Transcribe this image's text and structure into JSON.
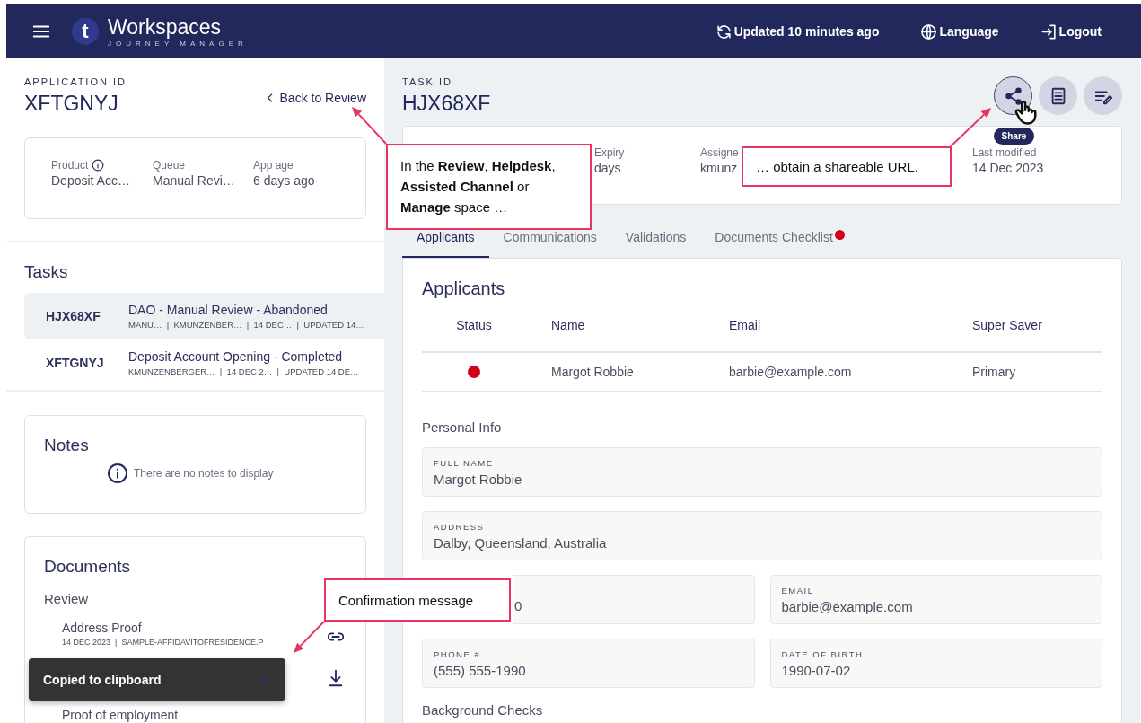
{
  "header": {
    "brand_initial": "t",
    "brand_name": "Workspaces",
    "brand_subtitle": "JOURNEY MANAGER",
    "actions": [
      {
        "label": "Updated 10 minutes ago"
      },
      {
        "label": "Language"
      },
      {
        "label": "Logout"
      }
    ]
  },
  "application": {
    "label": "APPLICATION ID",
    "id": "XFTGNYJ",
    "back_link": "Back to Review",
    "fields": [
      {
        "label": "Product",
        "value": "Deposit Acc…",
        "info": true
      },
      {
        "label": "Queue",
        "value": "Manual Revi…",
        "info": false
      },
      {
        "label": "App age",
        "value": "6 days ago",
        "info": false
      }
    ]
  },
  "tasks": {
    "title": "Tasks",
    "items": [
      {
        "id": "HJX68XF",
        "title": "DAO - Manual Review - Abandoned",
        "meta": "MANU…  |  KMUNZENBER…  |  14 DEC…  |  UPDATED 14…",
        "selected": true
      },
      {
        "id": "XFTGNYJ",
        "title": "Deposit Account Opening - Completed",
        "meta": "KMUNZENBERGER…  |  14 DEC 2…  |  UPDATED 14 DE…",
        "selected": false
      }
    ]
  },
  "notes": {
    "title": "Notes",
    "empty_message": "There are no notes to display"
  },
  "documents": {
    "title": "Documents",
    "group": "Review",
    "items": [
      {
        "name": "Address Proof",
        "meta": "14 DEC 2023  |  SAMPLE-AFFIDAVITOFRESIDENCE.P"
      },
      {
        "name": "Proof of employment"
      }
    ]
  },
  "task": {
    "label": "TASK ID",
    "id": "HJX68XF",
    "actions": [
      {
        "hovered": true,
        "tooltip": "Share"
      },
      {
        "hovered": false
      },
      {
        "hovered": false
      }
    ],
    "fields": [
      {
        "label": "Expiry",
        "value": "days"
      },
      {
        "label": "Assigne",
        "value": "kmunz"
      },
      {
        "label": "Last modified",
        "value": "14 Dec 2023"
      }
    ],
    "tabs": [
      {
        "label": "Applicants",
        "selected": true,
        "alert": false
      },
      {
        "label": "Communications",
        "selected": false,
        "alert": false
      },
      {
        "label": "Validations",
        "selected": false,
        "alert": false
      },
      {
        "label": "Documents Checklist",
        "selected": false,
        "alert": true
      }
    ]
  },
  "applicants": {
    "title": "Applicants",
    "columns": [
      "Status",
      "Name",
      "Email",
      "Super Saver"
    ],
    "rows": [
      {
        "color": "#d0021b",
        "name": "Margot Robbie",
        "email": "barbie@example.com",
        "super_saver": "Primary"
      }
    ]
  },
  "personal_info": {
    "title": "Personal Info",
    "fields": [
      {
        "kind": "wide",
        "label": "FULL NAME",
        "value": "Margot Robbie"
      },
      {
        "kind": "wide",
        "label": "ADDRESS",
        "value": "Dalby, Queensland, Australia"
      },
      {
        "kind": "covered",
        "value": "0"
      },
      {
        "kind": "half",
        "label": "EMAIL",
        "value": "barbie@example.com"
      },
      {
        "kind": "half",
        "label": "PHONE #",
        "value": "(555) 555-1990"
      },
      {
        "kind": "half",
        "label": "DATE OF BIRTH",
        "value": "1990-07-02"
      }
    ]
  },
  "background_checks": {
    "title": "Background Checks"
  },
  "toast": {
    "message": "Copied to clipboard"
  },
  "callouts": [
    {
      "text": "In the **Review**, **Helpdesk**, **Assisted Channel** or **Manage** space …"
    },
    {
      "text": "… obtain a shareable URL."
    },
    {
      "text": "Confirmation message"
    }
  ]
}
